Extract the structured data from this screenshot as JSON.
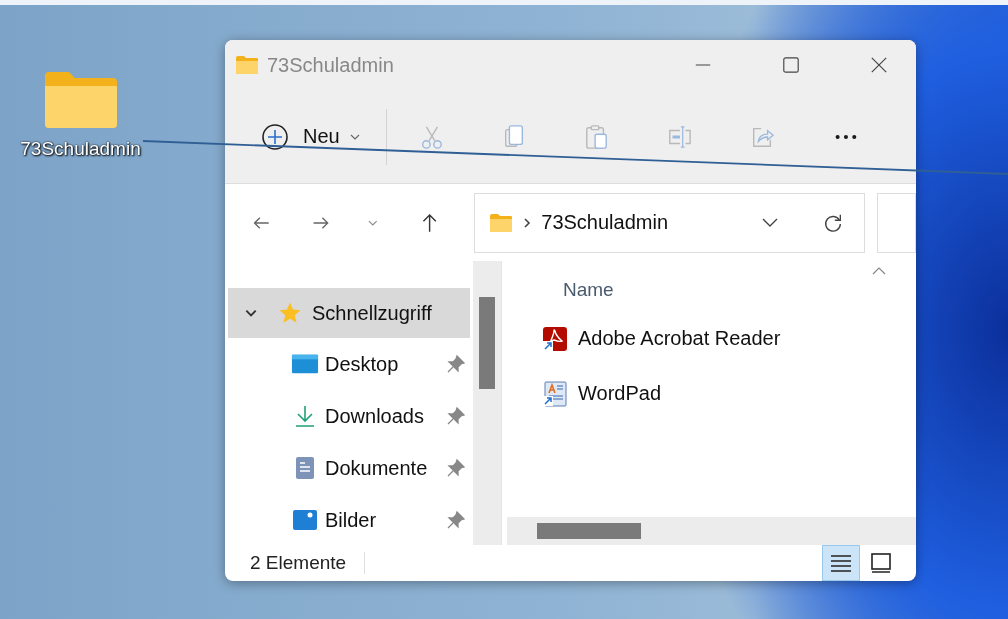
{
  "desktop": {
    "icons": [
      {
        "label": "73Schuladmin"
      }
    ]
  },
  "window": {
    "title": "73Schuladmin"
  },
  "toolbar": {
    "new_button": {
      "label": "Neu"
    },
    "actions": [
      {
        "kind": "cut",
        "disabled": true
      },
      {
        "kind": "copy",
        "disabled": true
      },
      {
        "kind": "paste",
        "disabled": true
      },
      {
        "kind": "rename",
        "disabled": true
      },
      {
        "kind": "share",
        "disabled": true
      },
      {
        "kind": "more",
        "disabled": false
      }
    ]
  },
  "address_bar": {
    "path": [
      "73Schuladmin"
    ]
  },
  "sidebar": {
    "items": [
      {
        "label": "Schnellzugriff",
        "kind": "star",
        "selected": true,
        "expanded": true,
        "children": [
          {
            "label": "Desktop",
            "kind": "desktop",
            "pinned": true,
            "selected": false
          },
          {
            "label": "Downloads",
            "kind": "download",
            "pinned": true,
            "selected": false
          },
          {
            "label": "Dokumente",
            "kind": "documents",
            "pinned": true,
            "selected": false
          },
          {
            "label": "Bilder",
            "kind": "pictures",
            "pinned": true,
            "selected": false
          }
        ]
      }
    ]
  },
  "file_list": {
    "columns": [
      "Name"
    ],
    "rows": [
      {
        "name": "Adobe Acrobat Reader",
        "kind": "pdf"
      },
      {
        "name": "WordPad",
        "kind": "wordpad"
      }
    ]
  },
  "status_bar": {
    "item_count": "2 Elemente",
    "views": [
      {
        "kind": "details",
        "selected": true
      },
      {
        "kind": "tiles",
        "selected": false
      }
    ]
  }
}
